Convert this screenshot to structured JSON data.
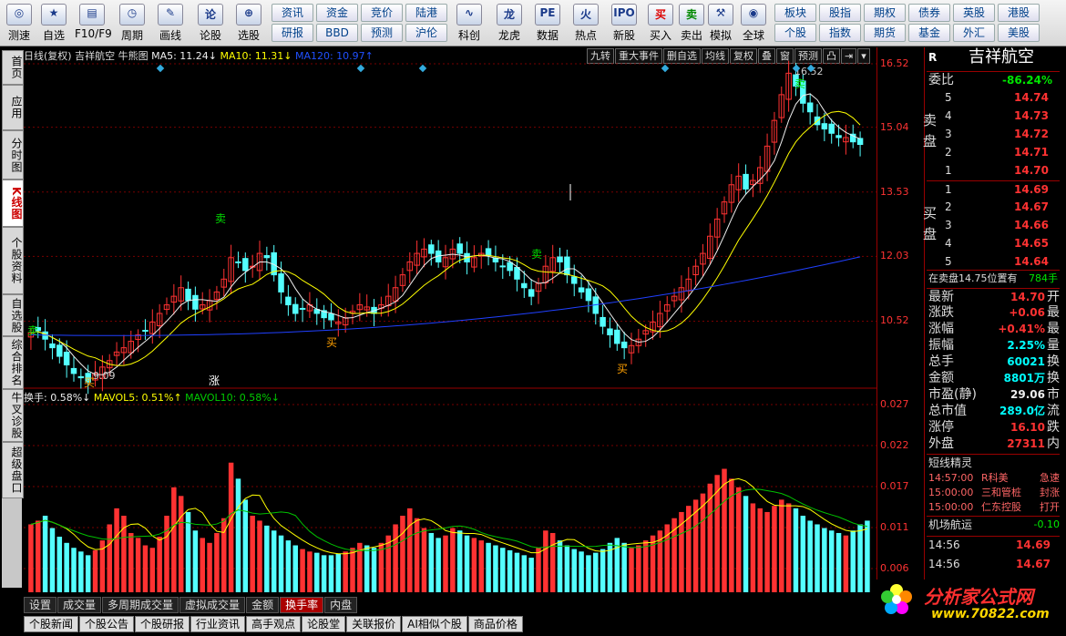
{
  "toolbar": {
    "buttons": [
      {
        "id": "test",
        "label": "测速",
        "icon": "globe-icon",
        "glyph": "◎"
      },
      {
        "id": "watchlist",
        "label": "自选",
        "icon": "star-icon",
        "glyph": "★"
      },
      {
        "id": "f10",
        "label": "F10/F9",
        "icon": "doc-icon",
        "glyph": "▤"
      },
      {
        "id": "period",
        "label": "周期",
        "icon": "clock-icon",
        "glyph": "◷"
      },
      {
        "id": "draw",
        "label": "画线",
        "icon": "pencil-icon",
        "glyph": "✎"
      },
      {
        "id": "comment",
        "label": "论股",
        "icon": "comment-icon",
        "glyph": "论"
      },
      {
        "id": "pick",
        "label": "选股",
        "icon": "magnifier-icon",
        "glyph": "⊕"
      },
      {
        "id": "kechuang",
        "label": "科创",
        "icon": "chart-icon",
        "glyph": "∿"
      },
      {
        "id": "dragon",
        "label": "龙虎",
        "icon": "dragon-icon",
        "glyph": "龙"
      },
      {
        "id": "data",
        "label": "数据",
        "icon": "pe-icon",
        "glyph": "PE"
      },
      {
        "id": "hot",
        "label": "热点",
        "icon": "fire-icon",
        "glyph": "火"
      },
      {
        "id": "ipo",
        "label": "新股",
        "icon": "ipo-icon",
        "glyph": "IPO"
      },
      {
        "id": "buy",
        "label": "买入",
        "icon": "buy-icon",
        "glyph": "买"
      },
      {
        "id": "sell",
        "label": "卖出",
        "icon": "sell-icon",
        "glyph": "卖"
      },
      {
        "id": "sim",
        "label": "模拟",
        "icon": "hammer-icon",
        "glyph": "⚒"
      },
      {
        "id": "global",
        "label": "全球",
        "icon": "earth-icon",
        "glyph": "◉"
      }
    ],
    "grid1": [
      "资讯",
      "资金",
      "竞价",
      "陆港",
      "研报",
      "BBD",
      "预测",
      "沪伦"
    ],
    "grid2": [
      "板块",
      "股指",
      "期权",
      "债券",
      "英股",
      "港股",
      "个股",
      "指数",
      "期货",
      "基金",
      "外汇",
      "美股"
    ]
  },
  "leftnav": [
    {
      "label": "首页",
      "active": false
    },
    {
      "label": "应用",
      "active": false
    },
    {
      "label": "分时图",
      "active": false
    },
    {
      "label": "K线图",
      "active": true
    },
    {
      "label": "个股资料",
      "active": false
    },
    {
      "label": "自选股",
      "active": false
    },
    {
      "label": "综合排名",
      "active": false
    },
    {
      "label": "牛叉诊股",
      "active": false
    },
    {
      "label": "超级盘口",
      "active": false
    }
  ],
  "chart_header": {
    "period": "日线(复权)",
    "stock": "吉祥航空",
    "indicator": "牛熊图",
    "ma5": "MA5: 11.24↓",
    "ma10": "MA10: 11.31↓",
    "ma120": "MA120: 10.97↑"
  },
  "chart_buttons": [
    "九转",
    "重大事件",
    "删自选",
    "均线",
    "复权",
    "叠",
    "窗",
    "预测",
    "凸",
    "⇥",
    "▾"
  ],
  "vol_header": {
    "turnover": "换手: 0.58%↓",
    "mavol5": "MAVOL5: 0.51%↑",
    "mavol10": "MAVOL10: 0.58%↓"
  },
  "annotations": {
    "high": "16.52",
    "low": "9.09",
    "buy": "买",
    "sell": "卖",
    "rise": "涨"
  },
  "chart_data": {
    "type": "candlestick",
    "price_ticks": [
      "16.52",
      "15.04",
      "13.53",
      "12.03",
      "10.52"
    ],
    "vol_ticks": [
      "0.027",
      "0.022",
      "0.017",
      "0.011",
      "0.006"
    ],
    "ylim": [
      9.0,
      16.52
    ],
    "closes": [
      10.25,
      10.3,
      10.1,
      9.9,
      9.7,
      9.5,
      9.3,
      9.2,
      9.1,
      9.3,
      9.45,
      9.6,
      9.8,
      9.9,
      10.05,
      10.2,
      10.3,
      10.5,
      10.7,
      10.9,
      11.1,
      11.3,
      11.0,
      10.8,
      10.9,
      11.0,
      11.2,
      11.5,
      12.0,
      11.9,
      11.7,
      11.8,
      12.1,
      12.0,
      11.6,
      11.2,
      10.9,
      10.7,
      10.8,
      10.9,
      10.7,
      10.6,
      10.55,
      10.5,
      10.6,
      10.75,
      10.9,
      10.85,
      10.7,
      10.9,
      11.1,
      11.3,
      11.6,
      11.9,
      12.1,
      12.2,
      12.1,
      11.9,
      12.0,
      12.2,
      12.1,
      11.9,
      12.0,
      12.1,
      12.05,
      11.9,
      11.8,
      11.7,
      11.5,
      11.3,
      11.1,
      11.4,
      11.8,
      12.0,
      11.9,
      11.6,
      11.4,
      11.2,
      11.0,
      10.7,
      10.4,
      10.2,
      10.0,
      9.9,
      9.95,
      10.1,
      10.3,
      10.5,
      10.7,
      10.9,
      11.1,
      11.3,
      11.5,
      11.8,
      12.1,
      12.5,
      12.9,
      13.3,
      13.7,
      13.9,
      13.6,
      13.8,
      14.1,
      14.6,
      15.2,
      15.8,
      16.3,
      16.0,
      15.6,
      15.4,
      15.1,
      15.0,
      14.9,
      14.8,
      14.8,
      14.7,
      14.64
    ],
    "turnover_pct": [
      0.55,
      0.58,
      0.62,
      0.52,
      0.45,
      0.4,
      0.36,
      0.33,
      0.3,
      0.34,
      0.42,
      0.55,
      0.68,
      0.62,
      0.48,
      0.44,
      0.38,
      0.36,
      0.45,
      0.62,
      0.85,
      0.78,
      0.65,
      0.5,
      0.44,
      0.4,
      0.48,
      0.6,
      1.05,
      0.92,
      0.75,
      0.62,
      0.58,
      0.54,
      0.5,
      0.46,
      0.42,
      0.38,
      0.35,
      0.33,
      0.32,
      0.3,
      0.3,
      0.31,
      0.33,
      0.36,
      0.4,
      0.38,
      0.36,
      0.4,
      0.46,
      0.55,
      0.62,
      0.68,
      0.6,
      0.52,
      0.48,
      0.44,
      0.46,
      0.52,
      0.5,
      0.46,
      0.44,
      0.42,
      0.4,
      0.38,
      0.36,
      0.34,
      0.32,
      0.3,
      0.28,
      0.36,
      0.5,
      0.48,
      0.42,
      0.38,
      0.35,
      0.33,
      0.3,
      0.32,
      0.35,
      0.4,
      0.44,
      0.4,
      0.36,
      0.38,
      0.42,
      0.46,
      0.5,
      0.55,
      0.6,
      0.65,
      0.7,
      0.75,
      0.8,
      0.88,
      0.95,
      1.0,
      0.92,
      0.85,
      0.78,
      0.72,
      0.68,
      0.65,
      0.7,
      0.75,
      0.72,
      0.68,
      0.62,
      0.58,
      0.55,
      0.52,
      0.5,
      0.48,
      0.46,
      0.5,
      0.55,
      0.58
    ]
  },
  "rightpanel": {
    "code": "R",
    "name": "吉祥航空",
    "weibi_label": "委比",
    "weibi_value": "-86.24%",
    "sell_label": "卖盘",
    "buy_label": "买盘",
    "sell": [
      {
        "lvl": "5",
        "price": "14.74"
      },
      {
        "lvl": "4",
        "price": "14.73"
      },
      {
        "lvl": "3",
        "price": "14.72"
      },
      {
        "lvl": "2",
        "price": "14.71"
      },
      {
        "lvl": "1",
        "price": "14.70"
      }
    ],
    "buy": [
      {
        "lvl": "1",
        "price": "14.69"
      },
      {
        "lvl": "2",
        "price": "14.67"
      },
      {
        "lvl": "3",
        "price": "14.66"
      },
      {
        "lvl": "4",
        "price": "14.65"
      },
      {
        "lvl": "5",
        "price": "14.64"
      }
    ],
    "notice_text": "在卖盘14.75位置有",
    "notice_vol": "784手",
    "quotes": [
      {
        "label": "最新",
        "value": "14.70",
        "cls": "red",
        "tail": "开"
      },
      {
        "label": "涨跌",
        "value": "+0.06",
        "cls": "red",
        "tail": "最"
      },
      {
        "label": "涨幅",
        "value": "+0.41%",
        "cls": "red",
        "tail": "最"
      },
      {
        "label": "振幅",
        "value": "2.25%",
        "cls": "cyan",
        "tail": "量"
      },
      {
        "label": "总手",
        "value": "60021",
        "cls": "cyan",
        "tail": "换"
      },
      {
        "label": "金额",
        "value": "8801万",
        "cls": "cyan",
        "tail": "换"
      },
      {
        "label": "市盈(静)",
        "value": "29.06",
        "cls": "white",
        "tail": "市"
      },
      {
        "label": "总市值",
        "value": "289.0亿",
        "cls": "cyan",
        "tail": "流"
      },
      {
        "label": "涨停",
        "value": "16.10",
        "cls": "red",
        "tail": "跌"
      },
      {
        "label": "外盘",
        "value": "27311",
        "cls": "red",
        "tail": "内"
      }
    ],
    "sprite_title": "短线精灵",
    "sprites": [
      {
        "time": "14:57:00",
        "name": "R科美",
        "event": "急速"
      },
      {
        "time": "15:00:00",
        "name": "三和管桩",
        "event": "封涨"
      },
      {
        "time": "15:00:00",
        "name": "仁东控股",
        "event": "打开"
      }
    ],
    "sector_name": "机场航运",
    "sector_value": "-0.10",
    "ticks": [
      {
        "time": "14:56",
        "price": "14.69"
      },
      {
        "time": "14:56",
        "price": "14.67"
      }
    ]
  },
  "bottom_tabs": [
    {
      "label": "设置",
      "active": false
    },
    {
      "label": "成交量",
      "active": false
    },
    {
      "label": "多周期成交量",
      "active": false
    },
    {
      "label": "虚拟成交量",
      "active": false
    },
    {
      "label": "金额",
      "active": false
    },
    {
      "label": "换手率",
      "active": true
    },
    {
      "label": "内盘",
      "active": false
    }
  ],
  "bottom_tabs2": [
    "个股新闻",
    "个股公告",
    "个股研报",
    "行业资讯",
    "高手观点",
    "论股堂",
    "关联报价",
    "AI相似个股",
    "商品价格"
  ],
  "logo": {
    "text": "分析家公式网",
    "url": "www.70822.com"
  },
  "colors": {
    "up": "#ff3232",
    "down": "#54ffff",
    "ma5": "#eeeeee",
    "ma10": "#ffff00",
    "ma120": "#2040ff"
  }
}
